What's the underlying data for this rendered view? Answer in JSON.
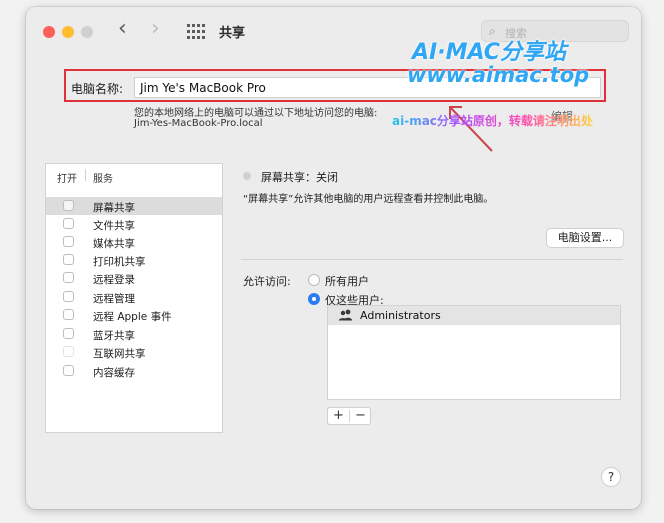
{
  "window": {
    "title": "共享",
    "search_placeholder": "搜索"
  },
  "toolbar": {
    "back_glyph": "‹",
    "forward_glyph": "›",
    "grid_icon": "grid-icon",
    "search_icon": "⌕"
  },
  "computer_name": {
    "label": "电脑名称:",
    "value": "Jim Ye's MacBook Pro",
    "hint": "您的本地网络上的电脑可以通过以下地址访问您的电脑:",
    "address": "Jim-Yes-MacBook-Pro.local",
    "edit_button": "编辑"
  },
  "watermark": {
    "line1": "AI·MAC分享站",
    "line2": "www.aimac.top",
    "line3": "ai-mac分享站原创，转载请注明出处"
  },
  "services": {
    "header_on": "打开",
    "header_service": "服务",
    "items": [
      {
        "label": "屏幕共享",
        "selected": true,
        "checked": false
      },
      {
        "label": "文件共享",
        "selected": false,
        "checked": false
      },
      {
        "label": "媒体共享",
        "selected": false,
        "checked": false
      },
      {
        "label": "打印机共享",
        "selected": false,
        "checked": false
      },
      {
        "label": "远程登录",
        "selected": false,
        "checked": false
      },
      {
        "label": "远程管理",
        "selected": false,
        "checked": false
      },
      {
        "label": "远程 Apple 事件",
        "selected": false,
        "checked": false
      },
      {
        "label": "蓝牙共享",
        "selected": false,
        "checked": false
      },
      {
        "label": "互联网共享",
        "selected": false,
        "checked": false
      },
      {
        "label": "内容缓存",
        "selected": false,
        "checked": false
      }
    ]
  },
  "detail": {
    "status": "屏幕共享：关闭",
    "description": "“屏幕共享”允许其他电脑的用户远程查看并控制此电脑。",
    "settings_button": "电脑设置...",
    "allow_label": "允许访问:",
    "option_all": "所有用户",
    "option_only": "仅这些用户:",
    "selected_option": "only",
    "users": [
      "Administrators"
    ],
    "add_glyph": "+",
    "remove_glyph": "−",
    "help_glyph": "?"
  },
  "colors": {
    "accent": "#2c7cf6",
    "highlight_box": "#e0303a",
    "watermark": "#2fa7f5"
  }
}
